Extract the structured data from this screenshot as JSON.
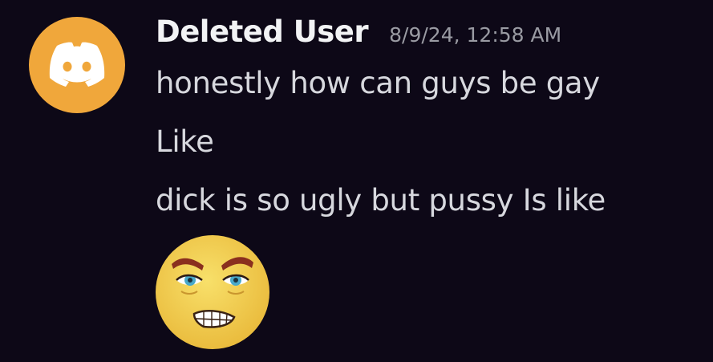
{
  "author": {
    "username": "Deleted User",
    "avatar_icon": "discord-logo-icon",
    "avatar_color": "#f0a73b"
  },
  "timestamp": "8/9/24, 12:58 AM",
  "messages": [
    "honestly how can guys be gay",
    "Like",
    "dick is so ugly but pussy Is like"
  ],
  "emoji": {
    "icon": "smirking-face-emoji-icon",
    "color": "#f3d550"
  },
  "colors": {
    "background": "#0d0817",
    "username": "#f2f3f5",
    "message_text": "#d7d8de",
    "timestamp": "#9a9ba3"
  }
}
